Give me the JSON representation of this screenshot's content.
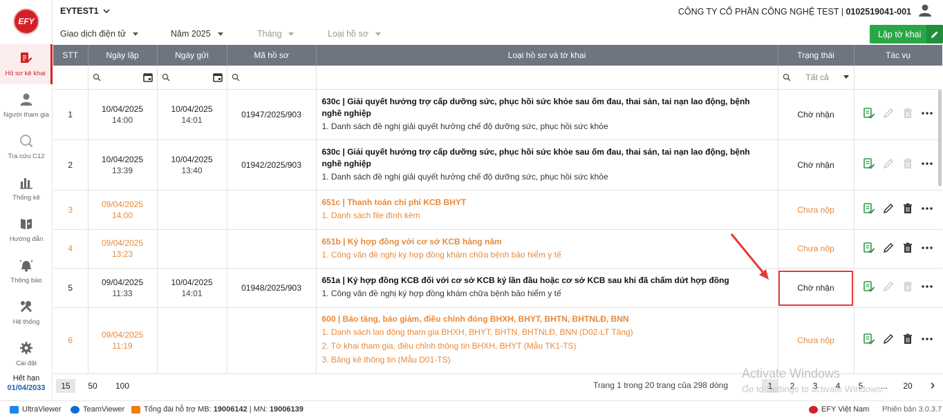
{
  "sidebar": {
    "logo": "EFY",
    "items": [
      {
        "label": "Hồ sơ kê khai",
        "icon": "document-edit-icon",
        "active": true
      },
      {
        "label": "Người tham gia",
        "icon": "person-icon"
      },
      {
        "label": "Tra cứu C12",
        "icon": "c12-search-icon"
      },
      {
        "label": "Thống kê",
        "icon": "bar-chart-icon"
      },
      {
        "label": "Hướng dẫn",
        "icon": "guide-book-icon"
      },
      {
        "label": "Thông báo",
        "icon": "bell-icon"
      },
      {
        "label": "Hệ thống",
        "icon": "tools-icon"
      },
      {
        "label": "Cài đặt",
        "icon": "gear-icon"
      }
    ],
    "expire_label": "Hết hạn",
    "expire_date": "01/04/2033"
  },
  "header": {
    "tenant": "EYTEST1",
    "company_name": "CÔNG TY CỔ PHẦN CÔNG NGHỆ TEST | ",
    "company_tax": "0102519041-001"
  },
  "filters": {
    "type": "Giao dịch điện tử",
    "year": "Năm 2025",
    "month": "Tháng",
    "doc_type": "Loại hồ sơ",
    "create_button": "Lập tờ khai"
  },
  "table": {
    "columns": [
      "STT",
      "Ngày lập",
      "Ngày gửi",
      "Mã hồ sơ",
      "Loại hồ sơ và tờ khai",
      "Trạng thái",
      "Tác vụ"
    ],
    "status_filter": "Tất cả",
    "rows": [
      {
        "stt": "1",
        "created_date": "10/04/2025",
        "created_time": "14:00",
        "sent_date": "10/04/2025",
        "sent_time": "14:01",
        "code": "01947/2025/903",
        "title": "630c | Giải quyết hưởng trợ cấp dưỡng sức, phục hồi sức khỏe sau ốm đau, thai sản, tai nạn lao động, bệnh nghề nghiệp",
        "subs": [
          "1. Danh sách đề nghị giải quyết hưởng chế độ dưỡng sức, phục hồi sức khỏe"
        ],
        "status": "Chờ nhận",
        "draft": false
      },
      {
        "stt": "2",
        "created_date": "10/04/2025",
        "created_time": "13:39",
        "sent_date": "10/04/2025",
        "sent_time": "13:40",
        "code": "01942/2025/903",
        "title": "630c | Giải quyết hưởng trợ cấp dưỡng sức, phục hồi sức khỏe sau ốm đau, thai sản, tai nạn lao động, bệnh nghề nghiệp",
        "subs": [
          "1. Danh sách đề nghị giải quyết hưởng chế độ dưỡng sức, phục hồi sức khỏe"
        ],
        "status": "Chờ nhận",
        "draft": false
      },
      {
        "stt": "3",
        "created_date": "09/04/2025",
        "created_time": "14:00",
        "sent_date": "",
        "sent_time": "",
        "code": "",
        "title": "651c | Thanh toán chi phí KCB BHYT",
        "subs": [
          "1. Danh sách file đính kèm"
        ],
        "status": "Chưa nộp",
        "draft": true
      },
      {
        "stt": "4",
        "created_date": "09/04/2025",
        "created_time": "13:23",
        "sent_date": "",
        "sent_time": "",
        "code": "",
        "title": "651b | Ký hợp đồng với cơ sở KCB hàng năm",
        "subs": [
          "1. Công văn đề nghị ký hợp đồng khám chữa bệnh bảo hiểm y tế"
        ],
        "status": "Chưa nộp",
        "draft": true
      },
      {
        "stt": "5",
        "created_date": "09/04/2025",
        "created_time": "11:33",
        "sent_date": "10/04/2025",
        "sent_time": "14:01",
        "code": "01948/2025/903",
        "title": "651a | Ký hợp đồng KCB đối với cơ sở KCB ký lần đầu hoặc cơ sở KCB sau khi đã chấm dứt hợp đồng",
        "subs": [
          "1. Công văn đề nghị ký hợp đồng khám chữa bệnh bảo hiểm y tế"
        ],
        "status": "Chờ nhận",
        "draft": false
      },
      {
        "stt": "6",
        "created_date": "09/04/2025",
        "created_time": "11:19",
        "sent_date": "",
        "sent_time": "",
        "code": "",
        "title": "600 | Báo tăng, báo giảm, điều chỉnh đóng BHXH, BHYT, BHTN, BHTNLĐ, BNN",
        "subs": [
          "1. Danh sách lao động tham gia BHXH, BHYT, BHTN, BHTNLĐ, BNN (D02-LT Tăng)",
          "2. Tờ khai tham gia, điều chỉnh thông tin BHXH, BHYT (Mẫu TK1-TS)",
          "3. Bảng kê thông tin (Mẫu D01-TS)"
        ],
        "status": "Chưa nộp",
        "draft": true
      }
    ]
  },
  "pager": {
    "sizes": [
      "15",
      "50",
      "100"
    ],
    "info": "Trang 1 trong 20 trang của 298 dòng",
    "pages": [
      "1",
      "2",
      "3",
      "4",
      "5",
      "...",
      "20"
    ],
    "prev": "‹",
    "next": "›"
  },
  "watermark": {
    "line1": "Activate Windows",
    "line2": "Go to Settings to activate Windows."
  },
  "statusbar": {
    "ultraviewer": "UltraViewer",
    "teamviewer": "TeamViewer",
    "hotline_label": "Tổng đài hỗ trợ MB: ",
    "hotline_mb": "19006142",
    "hotline_sep": " | MN: ",
    "hotline_mn": "19006139",
    "vendor": "EFY Việt Nam",
    "version": "Phiên bản 3.0.3.7"
  },
  "colors": {
    "brand": "#d32027",
    "header_bg": "#6d7580",
    "draft": "#e8893a",
    "create_button": "#27a745"
  }
}
